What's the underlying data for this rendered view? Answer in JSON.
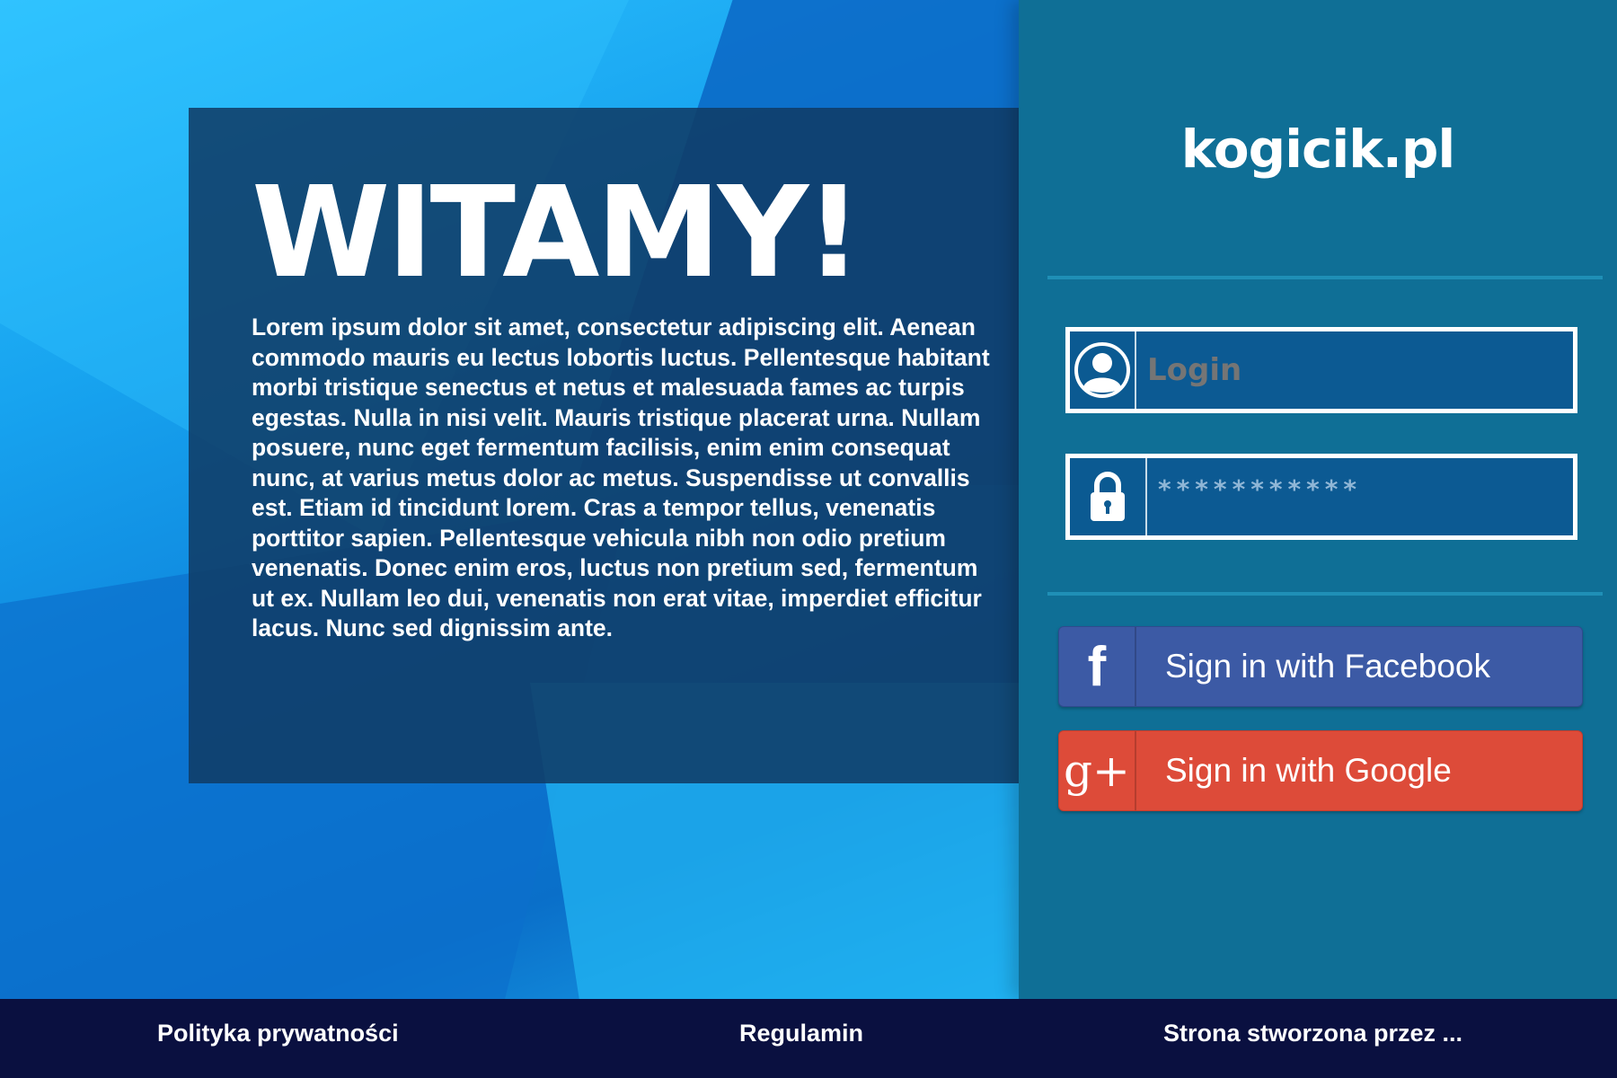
{
  "welcome": {
    "title": "WITAMY!",
    "text": "Lorem ipsum dolor sit amet, consectetur adipiscing elit. Aenean commodo mauris eu lectus lobortis luctus. Pellentesque habitant morbi tristique senectus et netus et malesuada fames ac turpis egestas. Nulla in nisi velit. Mauris tristique placerat urna. Nullam posuere, nunc eget fermentum facilisis, enim enim consequat nunc, at varius metus dolor ac metus. Suspendisse ut convallis est. Etiam id tincidunt lorem. Cras a tempor tellus, venenatis porttitor sapien. Pellentesque vehicula nibh non odio pretium venenatis. Donec enim eros, luctus non pretium sed, fermentum ut ex. Nullam leo dui, venenatis non erat vitae, imperdiet efficitur lacus. Nunc sed dignissim ante."
  },
  "panel": {
    "logo": "kogicik.pl",
    "login": {
      "placeholder": "Login",
      "icon": "user-icon"
    },
    "password": {
      "value": "***********",
      "icon": "lock-icon"
    },
    "facebook": {
      "label": "Sign in with Facebook",
      "icon_glyph": "f",
      "icon": "facebook-icon",
      "color": "#3c5aa5"
    },
    "google": {
      "label": "Sign in with Google",
      "icon_glyph": "g+",
      "icon": "google-plus-icon",
      "color": "#dd4b39"
    }
  },
  "footer": {
    "privacy": "Polityka prywatności",
    "terms": "Regulamin",
    "author": "Strona stworzona przez ..."
  },
  "colors": {
    "panel_bg": "#0f6f96",
    "welcome_bg": "#103c66",
    "footer_bg": "#0a1040"
  }
}
